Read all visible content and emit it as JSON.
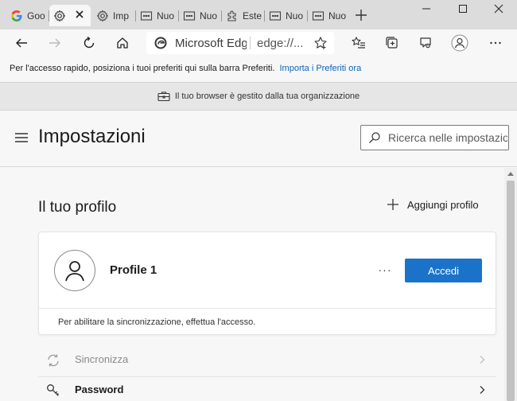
{
  "tabs": [
    {
      "label": "Goo",
      "icon": "google-icon",
      "active": false
    },
    {
      "label": "",
      "icon": "gear-icon",
      "active": true
    },
    {
      "label": "Imp",
      "icon": "gear-icon",
      "active": false
    },
    {
      "label": "Nuo",
      "icon": "newtab-icon",
      "active": false
    },
    {
      "label": "Nuo",
      "icon": "newtab-icon",
      "active": false
    },
    {
      "label": "Este",
      "icon": "puzzle-icon",
      "active": false
    },
    {
      "label": "Nuo",
      "icon": "newtab-icon",
      "active": false
    },
    {
      "label": "Nuo",
      "icon": "newtab-icon",
      "active": false
    }
  ],
  "address": {
    "site": "Microsoft Edge",
    "url": "edge://..."
  },
  "favorites_bar": {
    "text": "Per l'accesso rapido, posiziona i tuoi preferiti qui sulla barra Preferiti.",
    "link": "Importa i Preferiti ora"
  },
  "managed_bar": {
    "text": "Il tuo browser è gestito dalla tua organizzazione"
  },
  "settings": {
    "title": "Impostazioni",
    "search_placeholder": "Ricerca nelle impostazioni"
  },
  "profile_section": {
    "title": "Il tuo profilo",
    "add_profile": "Aggiungi profilo",
    "profile_name": "Profile 1",
    "more": "···",
    "signin": "Accedi",
    "sync_hint": "Per abilitare la sincronizzazione, effettua l'accesso."
  },
  "menu": [
    {
      "label": "Sincronizza",
      "icon": "sync-icon",
      "enabled": false
    },
    {
      "label": "Password",
      "icon": "key-icon",
      "enabled": true
    }
  ],
  "colors": {
    "accent": "#1a73c9",
    "link": "#0f62b8"
  }
}
